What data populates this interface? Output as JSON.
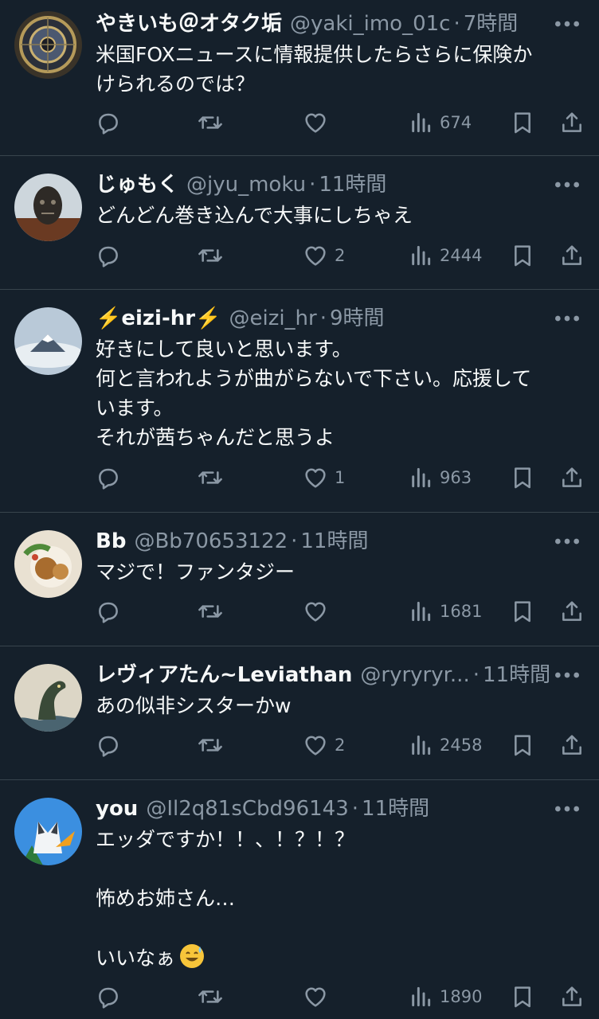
{
  "tweets": [
    {
      "name": "やきいも＠オタク垢",
      "handle": "@yaki_imo_01c",
      "time": "7時間",
      "text": "米国FOXニュースに情報提供したらさらに保険か\nけられるのでは？",
      "likes": "",
      "views": "674"
    },
    {
      "name": "じゅもく",
      "handle": "@jyu_moku",
      "time": "11時間",
      "text": "どんどん巻き込んで大事にしちゃえ",
      "likes": "2",
      "views": "2444"
    },
    {
      "name": "⚡️eizi-hr⚡️",
      "handle": "@eizi_hr",
      "time": "9時間",
      "text": "好きにして良いと思います。\n何と言われようが曲がらないで下さい。応援して\nいます。\nそれが茜ちゃんだと思うよ",
      "likes": "1",
      "views": "963"
    },
    {
      "name": "Bb",
      "handle": "@Bb70653122",
      "time": "11時間",
      "text": "マジで！ファンタジー",
      "likes": "",
      "views": "1681"
    },
    {
      "name": "レヴィアたん~Leviathan",
      "handle": "@ryryryr...",
      "time": "11時間",
      "text": "あの似非シスターかw",
      "likes": "2",
      "views": "2458"
    },
    {
      "name": "you",
      "handle": "@Il2q81sCbd96143",
      "time": "11時間",
      "text": "エッダですか！！、！？！？\n\n怖めお姉さん…\n\nいいなぁ",
      "likes": "",
      "views": "1890"
    }
  ],
  "icons": {
    "more": "more-icon",
    "reply": "reply-icon",
    "retweet": "retweet-icon",
    "like": "heart-icon",
    "views": "views-icon",
    "bookmark": "bookmark-icon",
    "share": "share-icon",
    "emoji": "sweat-smile-emoji"
  },
  "colors": {
    "background": "#15202b",
    "text": "#f7f9f9",
    "muted": "#8b98a5",
    "divider": "#38444d"
  }
}
